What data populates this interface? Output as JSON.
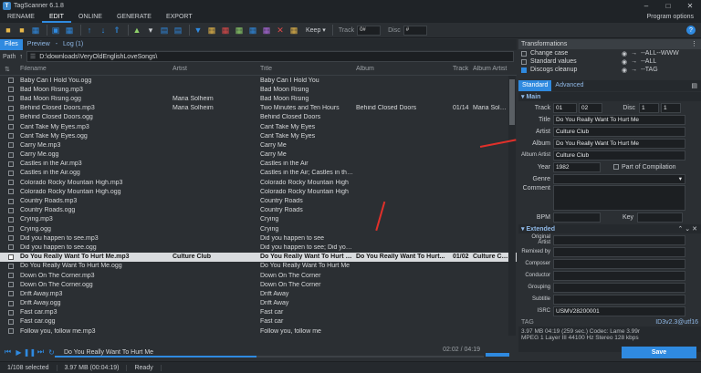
{
  "app": {
    "title": "TagScanner 6.1.8"
  },
  "menu": {
    "items": [
      "RENAME",
      "EDIT",
      "ONLINE",
      "GENERATE",
      "EXPORT"
    ],
    "active": "EDIT",
    "options": "Program options"
  },
  "toolbar": {
    "keep": "Keep",
    "track_label": "Track",
    "track_value": "0#",
    "disc_label": "Disc",
    "disc_value": "#"
  },
  "tabs": {
    "files": "Files",
    "preview": "Preview",
    "log": "Log (1)"
  },
  "path": {
    "label": "Path",
    "value": "D:\\downloads\\VeryOldEnglishLoveSongs\\"
  },
  "grid": {
    "headers": [
      "Filename",
      "Artist",
      "Title",
      "Album",
      "Track",
      "Album Artist"
    ],
    "rows": [
      [
        "Baby Can I Hold You.ogg",
        "",
        "Baby Can I Hold You",
        "",
        "",
        ""
      ],
      [
        "Bad Moon Rising.mp3",
        "",
        "Bad Moon Rising",
        "",
        "",
        ""
      ],
      [
        "Bad Moon Rising.ogg",
        "Maria Solheim",
        "Bad Moon Rising",
        "",
        "",
        ""
      ],
      [
        "Behind Closed Doors.mp3",
        "Maria Solheim",
        "Two Minutes and Ten Hours",
        "Behind Closed Doors",
        "01/14",
        "Maria Solheim"
      ],
      [
        "Behind Closed Doors.ogg",
        "",
        "Behind Closed Doors",
        "",
        "",
        ""
      ],
      [
        "Cant Take My Eyes.mp3",
        "",
        "Cant Take My Eyes",
        "",
        "",
        ""
      ],
      [
        "Cant Take My Eyes.ogg",
        "",
        "Cant Take My Eyes",
        "",
        "",
        ""
      ],
      [
        "Carry Me.mp3",
        "",
        "Carry Me",
        "",
        "",
        ""
      ],
      [
        "Carry Me.ogg",
        "",
        "Carry Me",
        "",
        "",
        ""
      ],
      [
        "Castles in the Air.mp3",
        "",
        "Castles in the Air",
        "",
        "",
        ""
      ],
      [
        "Castles in the Air.ogg",
        "",
        "Castles in the Air; Castles in the ...",
        "",
        "",
        ""
      ],
      [
        "Colorado Rocky Mountain High.mp3",
        "",
        "Colorado Rocky Mountain High",
        "",
        "",
        ""
      ],
      [
        "Colorado Rocky Mountain High.ogg",
        "",
        "Colorado Rocky Mountain High",
        "",
        "",
        ""
      ],
      [
        "Country Roads.mp3",
        "",
        "Country Roads",
        "",
        "",
        ""
      ],
      [
        "Country Roads.ogg",
        "",
        "Country Roads",
        "",
        "",
        ""
      ],
      [
        "Crying.mp3",
        "",
        "Crying",
        "",
        "",
        ""
      ],
      [
        "Crying.ogg",
        "",
        "Crying",
        "",
        "",
        ""
      ],
      [
        "Did you happen to see.mp3",
        "",
        "Did you happen to see",
        "",
        "",
        ""
      ],
      [
        "Did you happen to see.ogg",
        "",
        "Did you happen to see; Did you...",
        "",
        "",
        ""
      ],
      [
        "Do You Really Want To Hurt Me.mp3",
        "Culture Club",
        "Do You Really Want To Hurt Me",
        "Do You Really Want To Hurt...",
        "01/02",
        "Culture Club"
      ],
      [
        "Do You Really Want To Hurt Me.ogg",
        "",
        "Do You Really Want To Hurt Me",
        "",
        "",
        ""
      ],
      [
        "Down On The Corner.mp3",
        "",
        "Down On The Corner",
        "",
        "",
        ""
      ],
      [
        "Down On The Corner.ogg",
        "",
        "Down On The Corner",
        "",
        "",
        ""
      ],
      [
        "Drift Away.mp3",
        "",
        "Drift Away",
        "",
        "",
        ""
      ],
      [
        "Drift Away.ogg",
        "",
        "Drift Away",
        "",
        "",
        ""
      ],
      [
        "Fast car.mp3",
        "",
        "Fast car",
        "",
        "",
        ""
      ],
      [
        "Fast car.ogg",
        "",
        "Fast car",
        "",
        "",
        ""
      ],
      [
        "Follow you, follow me.mp3",
        "",
        "Follow you, follow me",
        "",
        "",
        ""
      ]
    ],
    "selected_index": 19
  },
  "player": {
    "track": "Do You Really Want To Hurt Me",
    "time": "02:02 / 04:19",
    "progress": 0.47
  },
  "status": {
    "selected": "1/108 selected",
    "size": "3.97 MB (00:04:19)",
    "state": "Ready"
  },
  "transformations": {
    "title": "Transformations",
    "items": [
      {
        "name": "Change case",
        "value": "--ALL--WWW",
        "checked": false
      },
      {
        "name": "Standard values",
        "value": "--ALL",
        "checked": false
      },
      {
        "name": "Discogs cleanup",
        "value": "--TAG",
        "checked": true
      }
    ]
  },
  "editor": {
    "tabs": [
      "Standard",
      "Advanced"
    ],
    "main_section": "Main",
    "track_label": "Track",
    "track": "01",
    "track_total": "02",
    "disc_label": "Disc",
    "disc": "1",
    "disc_total": "1",
    "title_label": "Title",
    "title": "Do You Really Want To Hurt Me",
    "artist_label": "Artist",
    "artist": "Culture Club",
    "album_label": "Album",
    "album": "Do You Really Want To Hurt Me",
    "album_artist_label": "Album Artist",
    "album_artist": "Culture Club",
    "year_label": "Year",
    "year": "1982",
    "compilation": "Part of Compilation",
    "genre_label": "Genre",
    "comment_label": "Comment",
    "bpm_label": "BPM",
    "key_label": "Key",
    "extended_section": "Extended",
    "ext_fields": [
      {
        "label": "Original Artist",
        "value": ""
      },
      {
        "label": "Remixed by",
        "value": ""
      },
      {
        "label": "Composer",
        "value": ""
      },
      {
        "label": "Conductor",
        "value": ""
      },
      {
        "label": "Grouping",
        "value": ""
      },
      {
        "label": "Subtitle",
        "value": ""
      },
      {
        "label": "ISRC",
        "value": "USMV28200001"
      }
    ],
    "tag_label": "TAG",
    "tag_version": "ID3v2.3@utf16",
    "tech_line1": "3.97 MB  04:19 (259 sec.)  Codec: Lame 3.99r",
    "tech_line2": "MPEG 1 Layer III  44100 Hz  Stereo  128 kbps",
    "save": "Save"
  }
}
